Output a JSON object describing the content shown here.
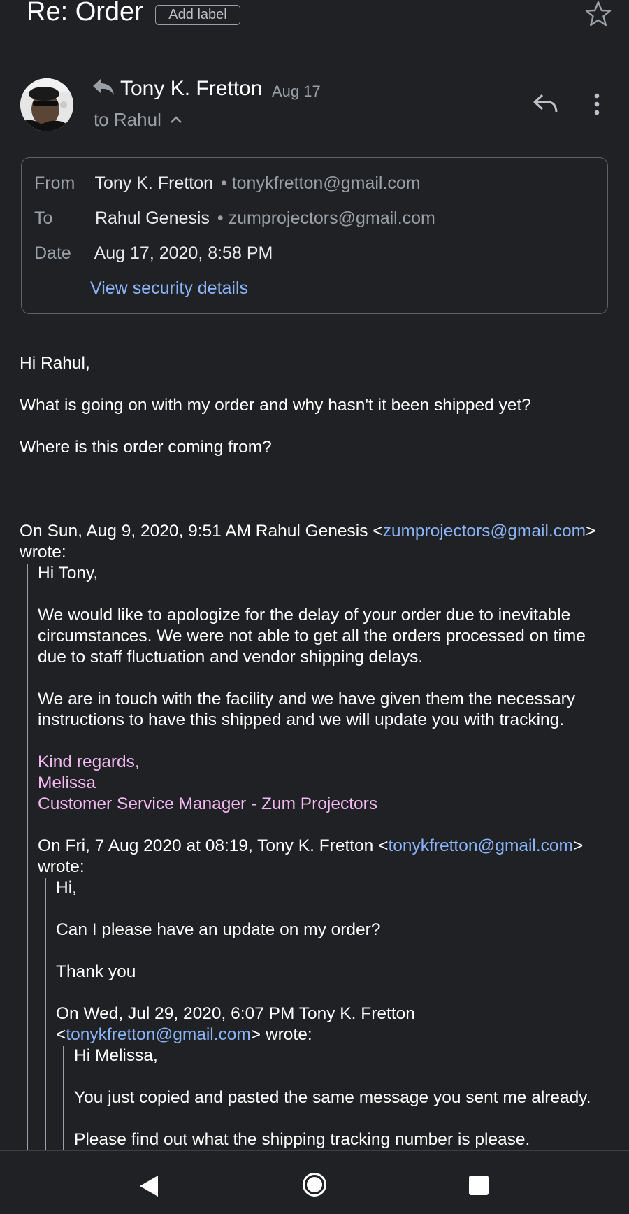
{
  "subject": "Re: Order",
  "add_label": "Add label",
  "sender": {
    "name": "Tony K. Fretton",
    "date": "Aug 17",
    "to_line": "to Rahul"
  },
  "details": {
    "from_label": "From",
    "from_name": "Tony K. Fretton",
    "from_email": "tonykfretton@gmail.com",
    "to_label": "To",
    "to_name": "Rahul Genesis",
    "to_email": "zumprojectors@gmail.com",
    "date_label": "Date",
    "date_value": "Aug 17, 2020, 8:58 PM",
    "security_link": "View security details",
    "separator": "•"
  },
  "body": {
    "greeting": "Hi Rahul,",
    "line1": "What is going on with my order and why hasn't it been shipped yet?",
    "line2": "Where is this order coming from?"
  },
  "quote1": {
    "header_prefix": "On Sun, Aug 9, 2020, 9:51 AM Rahul Genesis <",
    "header_email": "zumprojectors@gmail.com",
    "header_suffix": ">",
    "wrote": "wrote:",
    "greeting": "Hi Tony,",
    "para1_l1": "We would like to apologize for the delay of your order due to inevitable",
    "para1_l2": "circumstances. We were not able to get all the orders processed on time",
    "para1_l3": "due to staff fluctuation and vendor shipping delays.",
    "para2_l1": "We are in touch with the facility and we have given them the necessary",
    "para2_l2": "instructions to have this shipped and we will update you with tracking.",
    "sig1": "Kind regards,",
    "sig2": "Melissa",
    "sig3": "Customer Service Manager - Zum Projectors"
  },
  "quote2": {
    "header_prefix": "On Fri, 7 Aug 2020 at 08:19, Tony K. Fretton <",
    "header_email": "tonykfretton@gmail.com",
    "header_suffix": ">",
    "wrote": "wrote:",
    "greeting": "Hi,",
    "line1": "Can I please have an update on my order?",
    "line2": "Thank you"
  },
  "quote3": {
    "header_l1": "On Wed, Jul 29, 2020, 6:07 PM Tony K. Fretton",
    "header_l2_prefix": "<",
    "header_email": "tonykfretton@gmail.com",
    "header_l2_suffix": "> wrote:",
    "greeting": "Hi Melissa,",
    "line1": "You just copied and pasted the same message you sent me already.",
    "line2": "Please find out what the shipping tracking number is please."
  },
  "colors": {
    "background": "#202124",
    "link": "#8ab4f8",
    "signature": "#f3b8f2",
    "muted": "#9aa0a6"
  },
  "icons": {
    "star": "star-icon",
    "reply_small": "reply-indicator-icon",
    "chevron": "chevron-up-icon",
    "reply": "reply-icon",
    "more": "more-vert-icon",
    "nav_back": "nav-back-icon",
    "nav_home": "nav-home-icon",
    "nav_recent": "nav-recents-icon"
  }
}
